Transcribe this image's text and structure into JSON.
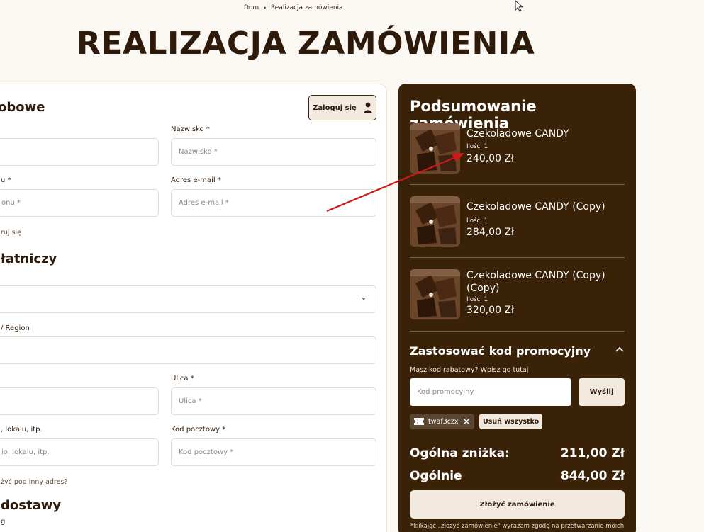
{
  "breadcrumb": {
    "home": "Dom",
    "separator": "•",
    "current": "Realizacja zamówienia"
  },
  "page_title": "REALIZACJA ZAMÓWIENIA",
  "form": {
    "section_personal": "obowe",
    "login_label": "Zaloguj się",
    "lastname_label": "Nazwisko *",
    "lastname_placeholder": "Nazwisko *",
    "phone_label": "u *",
    "phone_placeholder": "onu *",
    "email_label": "Adres e-mail *",
    "email_placeholder": "Adres e-mail *",
    "register_text": "ruj się",
    "section_billing": "łatniczy",
    "region_label": "/ Region",
    "street_label": "Ulica *",
    "street_placeholder": "Ulica *",
    "apartment_label": ", lokalu, itp.",
    "apartment_placeholder": "io, lokalu, itp.",
    "postal_label": "Kod pocztowy *",
    "postal_placeholder": "Kod pocztowy *",
    "other_address": "żyć pod inny adres?",
    "section_shipping": "dostawy",
    "shipping_partial": "g"
  },
  "summary": {
    "title": "Podsumowanie zamówienia",
    "items": [
      {
        "name": "Czekoladowe CANDY",
        "qty": "Ilość: 1",
        "price": "240,00 Zł"
      },
      {
        "name": "Czekoladowe CANDY (Copy)",
        "qty": "Ilość: 1",
        "price": "284,00 Zł"
      },
      {
        "name": "Czekoladowe CANDY (Copy) (Copy)",
        "qty": "Ilość: 1",
        "price": "320,00 Zł"
      }
    ],
    "promo_title": "Zastosować kod promocyjny",
    "promo_hint": "Masz kod rabatowy? Wpisz go tutaj",
    "promo_placeholder": "Kod promocyjny",
    "send_label": "Wyślij",
    "coupon_code": "twaf3czx",
    "remove_all": "Usuń wszystko",
    "discount_label": "Ogólna zniżka:",
    "discount_value": "211,00 Zł",
    "total_label": "Ogólnie",
    "total_value": "844,00 Zł",
    "order_button": "Złożyć zamówienie",
    "consent": "*klikając „złożyć zamówienie\" wyrażam zgodę na przetwarzanie moich"
  },
  "colors": {
    "panel": "#3a2208",
    "accent": "#f3eadf",
    "annotation_arrow": "#d01818"
  }
}
